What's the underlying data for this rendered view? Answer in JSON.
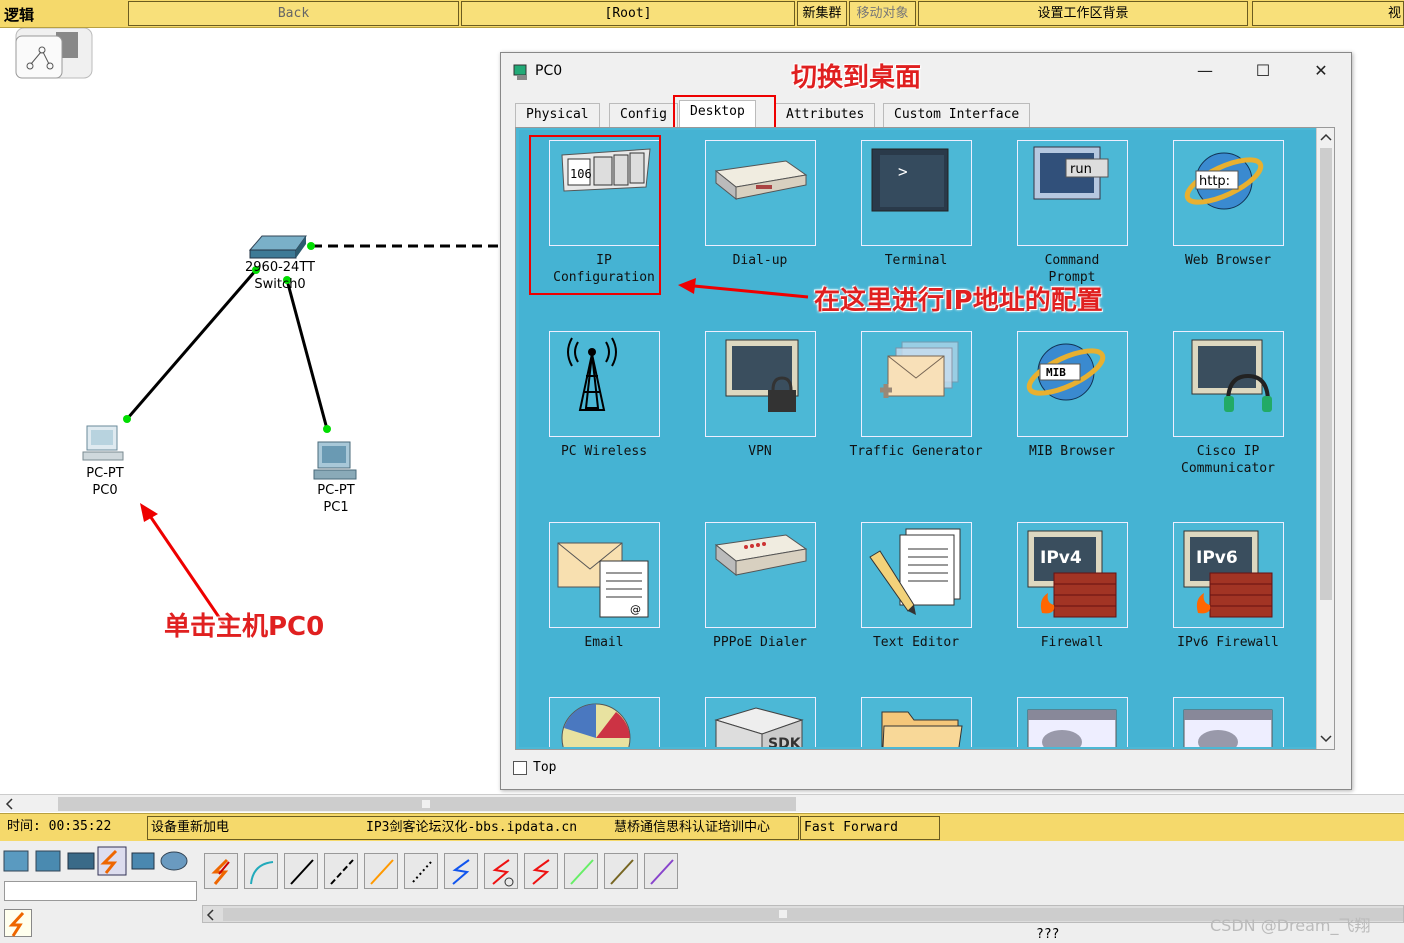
{
  "topbar": {
    "logic_label": "逻辑",
    "back": "Back",
    "root": "[Root]",
    "new_cluster": "新集群",
    "move_object": "移动对象",
    "set_bg": "设置工作区背景",
    "view_cut": "视"
  },
  "devices": {
    "switch": {
      "model": "2960-24TT",
      "name": "Switch0"
    },
    "pc0": {
      "model": "PC-PT",
      "name": "PC0"
    },
    "pc1": {
      "model": "PC-PT",
      "name": "PC1"
    }
  },
  "window": {
    "title": "PC0",
    "minimize": "—",
    "maximize": "☐",
    "close": "✕",
    "tabs": [
      "Physical",
      "Config",
      "Desktop",
      "Attributes",
      "Custom Interface"
    ],
    "active_tab": "Desktop",
    "top_checkbox_label": "Top"
  },
  "apps": [
    {
      "label": "IP\nConfiguration",
      "icon": "ip-config-icon"
    },
    {
      "label": "Dial-up",
      "icon": "modem-icon"
    },
    {
      "label": "Terminal",
      "icon": "terminal-icon"
    },
    {
      "label": "Command\nPrompt",
      "icon": "command-prompt-icon"
    },
    {
      "label": "Web Browser",
      "icon": "web-browser-icon"
    },
    {
      "label": "PC Wireless",
      "icon": "wireless-tower-icon"
    },
    {
      "label": "VPN",
      "icon": "vpn-lock-icon"
    },
    {
      "label": "Traffic Generator",
      "icon": "traffic-generator-icon"
    },
    {
      "label": "MIB Browser",
      "icon": "mib-browser-icon"
    },
    {
      "label": "Cisco IP\nCommunicator",
      "icon": "headset-icon"
    },
    {
      "label": "Email",
      "icon": "email-icon"
    },
    {
      "label": "PPPoE Dialer",
      "icon": "pppoe-dialer-icon"
    },
    {
      "label": "Text Editor",
      "icon": "text-editor-icon"
    },
    {
      "label": "Firewall",
      "icon": "firewall-icon"
    },
    {
      "label": "IPv6 Firewall",
      "icon": "ipv6-firewall-icon"
    }
  ],
  "app_icon_text": {
    "ip": "106",
    "run": "run",
    "http": "http:",
    "mib": "MIB",
    "ipv4": "IPv4",
    "ipv6": "IPv6",
    "sdk": "SDK"
  },
  "annotations": {
    "switch_to_desktop": "切换到桌面",
    "config_here": "在这里进行IP地址的配置",
    "click_pc0": "单击主机PC0"
  },
  "statusbar": {
    "time": "时间: 00:35:22",
    "power_cycle": "设备重新加电",
    "forum": "IP3剑客论坛汉化-bbs.ipdata.cn",
    "training": "慧桥通信思科认证培训中心",
    "fast_forward": "Fast Forward Time"
  },
  "bottom": {
    "placeholder_text": "???"
  },
  "watermark": "CSDN @Dream_飞翔",
  "colors": {
    "toolbar_yellow": "#f5d96b",
    "desktop_blue": "#45b3d3",
    "annotation_red": "#e02020",
    "link_green": "#00dd00"
  }
}
